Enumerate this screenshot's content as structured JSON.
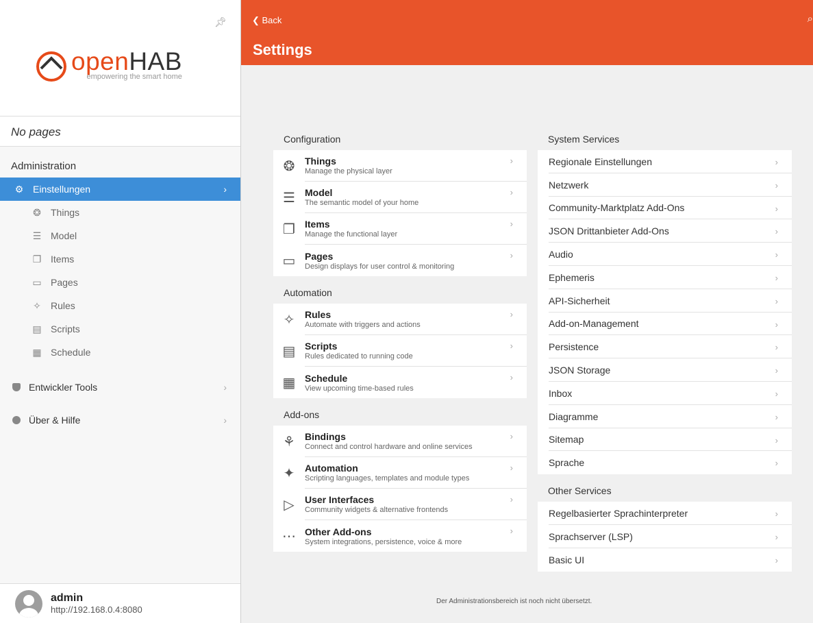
{
  "sidebar": {
    "logo": {
      "word_open": "open",
      "word_hab": "HAB",
      "tagline": "empowering the smart home"
    },
    "no_pages": "No pages",
    "admin_title": "Administration",
    "settings_label": "Einstellungen",
    "sub_items": [
      {
        "label": "Things",
        "icon": "bulb-icon"
      },
      {
        "label": "Model",
        "icon": "list-icon"
      },
      {
        "label": "Items",
        "icon": "items-icon"
      },
      {
        "label": "Pages",
        "icon": "monitor-icon"
      },
      {
        "label": "Rules",
        "icon": "wand-icon"
      },
      {
        "label": "Scripts",
        "icon": "script-icon"
      },
      {
        "label": "Schedule",
        "icon": "calendar-icon"
      }
    ],
    "dev_tools": "Entwickler Tools",
    "help": "Über & Hilfe",
    "user": {
      "name": "admin",
      "url": "http://192.168.0.4:8080"
    }
  },
  "header": {
    "back": "Back",
    "title": "Settings"
  },
  "configuration": {
    "title": "Configuration",
    "items": [
      {
        "title": "Things",
        "subtitle": "Manage the physical layer",
        "icon": "bulb-icon"
      },
      {
        "title": "Model",
        "subtitle": "The semantic model of your home",
        "icon": "list-icon"
      },
      {
        "title": "Items",
        "subtitle": "Manage the functional layer",
        "icon": "items-icon"
      },
      {
        "title": "Pages",
        "subtitle": "Design displays for user control & monitoring",
        "icon": "monitor-icon"
      }
    ]
  },
  "automation": {
    "title": "Automation",
    "items": [
      {
        "title": "Rules",
        "subtitle": "Automate with triggers and actions",
        "icon": "wand-icon"
      },
      {
        "title": "Scripts",
        "subtitle": "Rules dedicated to running code",
        "icon": "script-icon"
      },
      {
        "title": "Schedule",
        "subtitle": "View upcoming time-based rules",
        "icon": "calendar-icon"
      }
    ]
  },
  "addons": {
    "title": "Add-ons",
    "items": [
      {
        "title": "Bindings",
        "subtitle": "Connect and control hardware and online services",
        "icon": "bindings-icon"
      },
      {
        "title": "Automation",
        "subtitle": "Scripting languages, templates and module types",
        "icon": "sparkle-icon"
      },
      {
        "title": "User Interfaces",
        "subtitle": "Community widgets & alternative frontends",
        "icon": "play-icon"
      },
      {
        "title": "Other Add-ons",
        "subtitle": "System integrations, persistence, voice & more",
        "icon": "dots-icon"
      }
    ]
  },
  "system_services": {
    "title": "System Services",
    "items": [
      "Regionale Einstellungen",
      "Netzwerk",
      "Community-Marktplatz Add-Ons",
      "JSON Drittanbieter Add-Ons",
      "Audio",
      "Ephemeris",
      "API-Sicherheit",
      "Add-on-Management",
      "Persistence",
      "JSON Storage",
      "Inbox",
      "Diagramme",
      "Sitemap",
      "Sprache"
    ]
  },
  "other_services": {
    "title": "Other Services",
    "items": [
      "Regelbasierter Sprachinterpreter",
      "Sprachserver (LSP)",
      "Basic UI"
    ]
  },
  "footer_note": "Der Administrationsbereich ist noch nicht übersetzt.",
  "colors": {
    "accent": "#e8542a",
    "active": "#3d8ed8"
  }
}
